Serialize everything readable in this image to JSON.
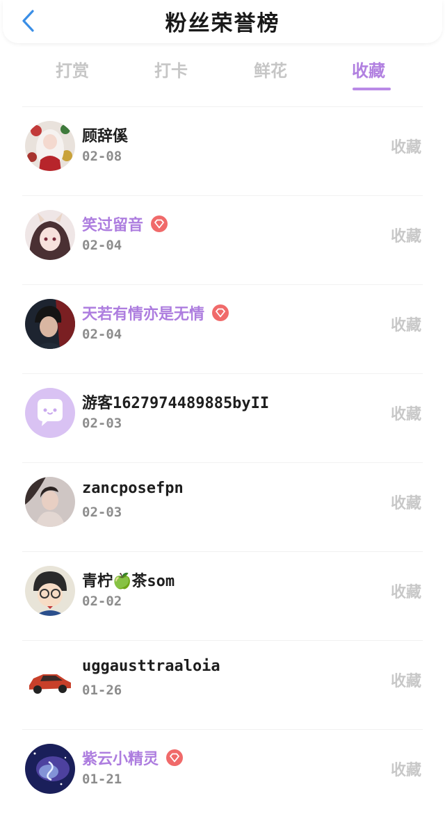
{
  "header": {
    "title": "粉丝荣誉榜",
    "back_icon": "chevron-left-icon"
  },
  "tabs": [
    {
      "label": "打赏",
      "active": false
    },
    {
      "label": "打卡",
      "active": false
    },
    {
      "label": "鲜花",
      "active": false
    },
    {
      "label": "收藏",
      "active": true
    }
  ],
  "colors": {
    "accent": "#b180e0",
    "vip_badge": "#f06a6a",
    "inactive_tab": "#c6c6c6"
  },
  "fans": [
    {
      "name": "顾辞傒",
      "date": "02-08",
      "action": "收藏",
      "vip": false,
      "avatar": "anime-girl-white-hair-avatar"
    },
    {
      "name": "笑过留音",
      "date": "02-04",
      "action": "收藏",
      "vip": true,
      "avatar": "anime-girl-horns-avatar"
    },
    {
      "name": "天若有情亦是无情",
      "date": "02-04",
      "action": "收藏",
      "vip": true,
      "avatar": "anime-boy-dark-avatar"
    },
    {
      "name": "游客1627974489885byII",
      "date": "02-03",
      "action": "收藏",
      "vip": false,
      "avatar": "default-chat-avatar"
    },
    {
      "name": "zancposefpn",
      "date": "02-03",
      "action": "收藏",
      "vip": false,
      "avatar": "girl-photo-avatar"
    },
    {
      "name": "青柠🍏茶som",
      "date": "02-02",
      "action": "收藏",
      "vip": false,
      "avatar": "cartoon-detective-avatar"
    },
    {
      "name": "uggausttraaloia",
      "date": "01-26",
      "action": "收藏",
      "vip": false,
      "avatar": "red-car-avatar"
    },
    {
      "name": "紫云小精灵",
      "date": "01-21",
      "action": "收藏",
      "vip": true,
      "avatar": "galaxy-avatar"
    }
  ]
}
